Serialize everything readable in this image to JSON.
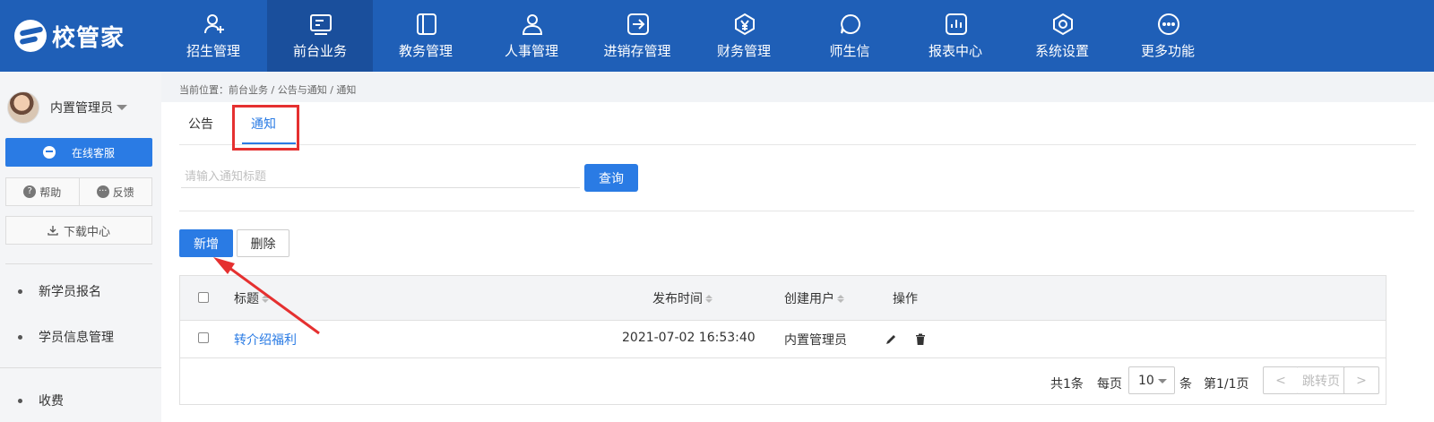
{
  "app": {
    "brand_name": "校管家"
  },
  "topnav": {
    "items": [
      {
        "label": "招生管理",
        "icon": "user-add-icon"
      },
      {
        "label": "前台业务",
        "icon": "card-icon",
        "active": true
      },
      {
        "label": "教务管理",
        "icon": "book-icon"
      },
      {
        "label": "人事管理",
        "icon": "person-icon"
      },
      {
        "label": "进销存管理",
        "icon": "inventory-icon"
      },
      {
        "label": "财务管理",
        "icon": "finance-yen-icon"
      },
      {
        "label": "师生信",
        "icon": "message-icon"
      },
      {
        "label": "报表中心",
        "icon": "chart-icon"
      },
      {
        "label": "系统设置",
        "icon": "settings-hex-icon"
      },
      {
        "label": "更多功能",
        "icon": "more-dots-icon"
      }
    ]
  },
  "sidebar": {
    "user_name": "内置管理员",
    "online_service": "在线客服",
    "help": "帮助",
    "feedback": "反馈",
    "download_center": "下载中心",
    "menu": [
      {
        "label": "新学员报名"
      },
      {
        "label": "学员信息管理"
      },
      {
        "label": "收费"
      }
    ]
  },
  "breadcrumb": "当前位置：前台业务 / 公告与通知 / 通知",
  "tabs": [
    {
      "label": "公告"
    },
    {
      "label": "通知",
      "active": true
    }
  ],
  "search": {
    "placeholder": "请输入通知标题",
    "value": "",
    "button": "查询"
  },
  "actions": {
    "add": "新增",
    "delete": "删除"
  },
  "table": {
    "columns": [
      "标题",
      "发布时间",
      "创建用户",
      "操作"
    ],
    "rows": [
      {
        "title": "转介绍福利",
        "publish_time": "2021-07-02 16:53:40",
        "creator": "内置管理员"
      }
    ]
  },
  "pagination": {
    "total": "共1条",
    "per_page_label": "每页",
    "per_page": "10",
    "unit": "条",
    "page": "第1/1页",
    "jump_placeholder": "跳转页",
    "prev": "<",
    "next": ">"
  },
  "colors": {
    "nav_bg": "#1f5fb7",
    "primary": "#2a7be4",
    "annotation": "#e53030"
  }
}
